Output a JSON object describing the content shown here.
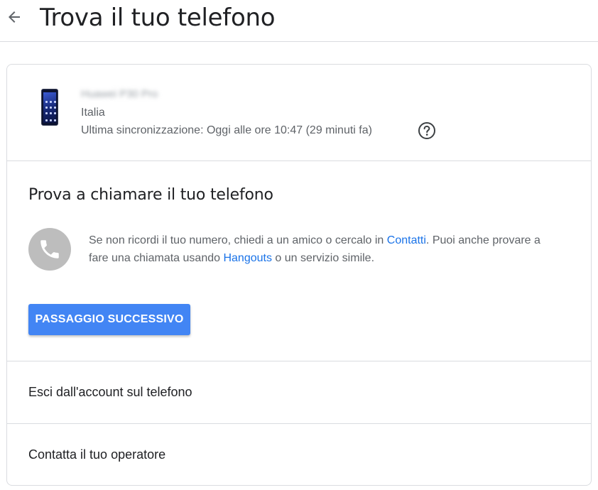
{
  "header": {
    "title": "Trova il tuo telefono",
    "back_icon": "arrow-back-icon"
  },
  "device": {
    "name": "Huawei P30 Pro",
    "country": "Italia",
    "last_sync": "Ultima sincronizzazione: Oggi alle ore 10:47 (29 minuti fa)",
    "help_icon": "help-circle-icon"
  },
  "call_section": {
    "title": "Prova a chiamare il tuo telefono",
    "icon": "phone-icon",
    "text_1": "Se non ricordi il tuo numero, chiedi a un amico o cercalo in ",
    "link_contacts": "Contatti",
    "text_2": ". Puoi anche provare a fare una chiamata usando ",
    "link_hangouts": "Hangouts",
    "text_3": " o un servizio simile.",
    "next_button": "PASSAGGIO SUCCESSIVO"
  },
  "options": {
    "sign_out": "Esci dall'account sul telefono",
    "carrier": "Contatta il tuo operatore"
  },
  "colors": {
    "accent": "#4285f4",
    "link": "#1a73e8",
    "divider": "#dadce0",
    "icon_bg": "#bdbdbd"
  }
}
